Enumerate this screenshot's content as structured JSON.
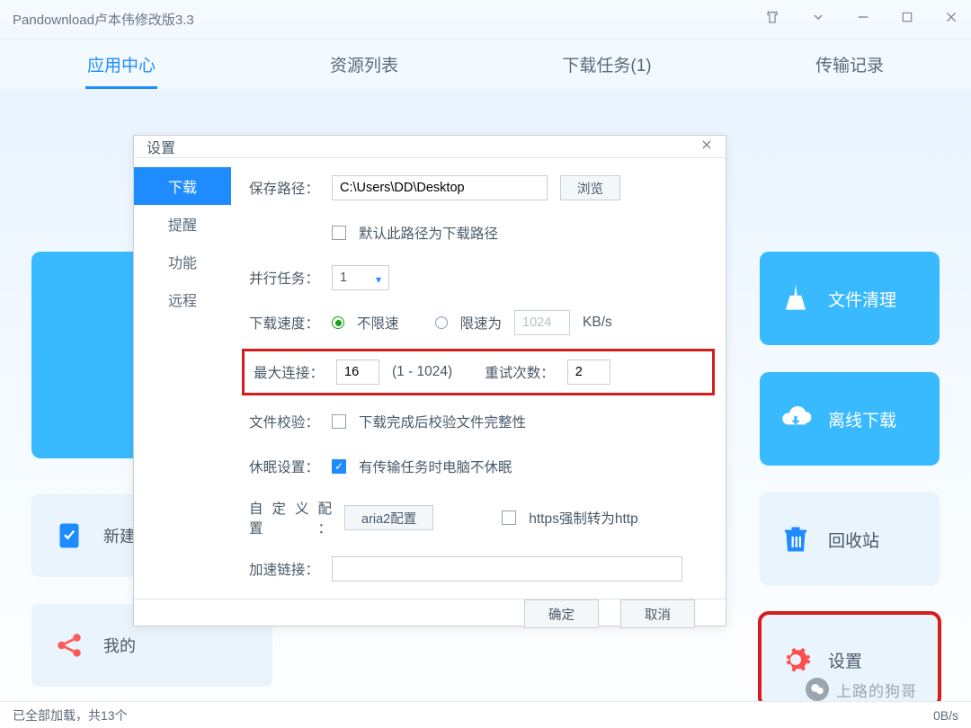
{
  "window": {
    "title": "Pandownload卢本伟修改版3.3"
  },
  "tabs": {
    "app_center": "应用中心",
    "resource_list": "资源列表",
    "download_tasks": "下载任务(1)",
    "transfer_log": "传输记录"
  },
  "left_cards": {
    "new": "新建",
    "my": "我的"
  },
  "right_cards": {
    "file_clean": "文件清理",
    "offline_dl": "离线下载",
    "recycle": "回收站",
    "settings": "设置"
  },
  "status": {
    "left": "已全部加载，共13个",
    "right": "0B/s"
  },
  "modal": {
    "title": "设置",
    "side": {
      "download": "下载",
      "remind": "提醒",
      "function": "功能",
      "remote": "远程"
    },
    "save_path_lbl": "保存路径：",
    "save_path_val": "C:\\Users\\DD\\Desktop",
    "browse": "浏览",
    "default_path_chk": "默认此路径为下载路径",
    "parallel_lbl": "并行任务：",
    "parallel_val": "1",
    "speed_lbl": "下载速度：",
    "speed_unlimited": "不限速",
    "speed_limit": "限速为",
    "speed_limit_val": "1024",
    "speed_unit": "KB/s",
    "maxconn_lbl": "最大连接：",
    "maxconn_val": "16",
    "maxconn_range": "(1 - 1024)",
    "retry_lbl": "重试次数：",
    "retry_val": "2",
    "verify_lbl": "文件校验：",
    "verify_chk": "下载完成后校验文件完整性",
    "sleep_lbl": "休眠设置：",
    "sleep_chk": "有传输任务时电脑不休眠",
    "custom_lbl": "自定义配置：",
    "aria2_btn": "aria2配置",
    "https_chk": "https强制转为http",
    "accel_lbl": "加速链接：",
    "ok": "确定",
    "cancel": "取消"
  },
  "watermark": "上路的狗哥",
  "colors": {
    "accent": "#1e8cff",
    "tile": "#39baff",
    "red": "#d81b1b"
  }
}
